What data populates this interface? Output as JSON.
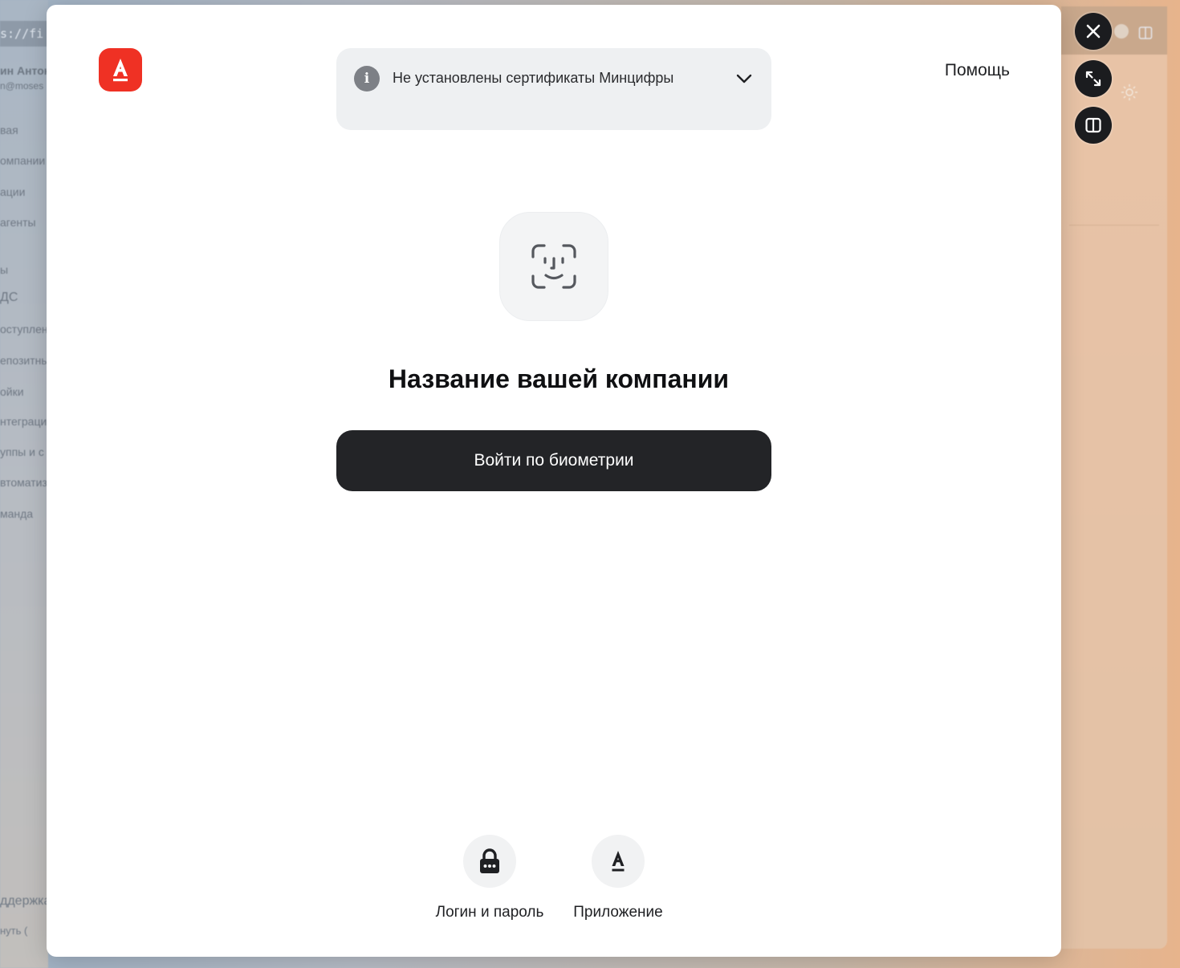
{
  "background": {
    "url_fragment": "s://fi",
    "user_name": "ин Антон",
    "user_email": "n@moses",
    "menu_items": [
      "вая",
      "омпании",
      "ации",
      "агенты",
      "ы",
      "ДС",
      "оступлен",
      "епозитны",
      "ойки",
      "нтеграци",
      "уппы и с",
      "втоматиз",
      "манда"
    ],
    "bottom_items": [
      "ддержка",
      "нуть    ("
    ]
  },
  "modal": {
    "help_label": "Помощь",
    "notice": {
      "icon": "info-icon",
      "icon_glyph": "i",
      "text": "Не установлены сертификаты Минцифры",
      "chevron": "chevron-down-icon"
    },
    "face_icon": "face-id-icon",
    "company_name": "Название вашей компании",
    "biometric_button": "Войти по биометрии",
    "alt_options": [
      {
        "label": "Логин и пароль",
        "icon": "lock-icon"
      },
      {
        "label": "Приложение",
        "icon": "alfa-app-icon"
      }
    ]
  },
  "controls": {
    "close_icon": "close-icon",
    "expand_icon": "expand-icon",
    "split_icon": "split-view-icon"
  },
  "colors": {
    "brand": "#ef3124",
    "button_dark": "#232427",
    "notice_bg": "#eef0f2"
  }
}
